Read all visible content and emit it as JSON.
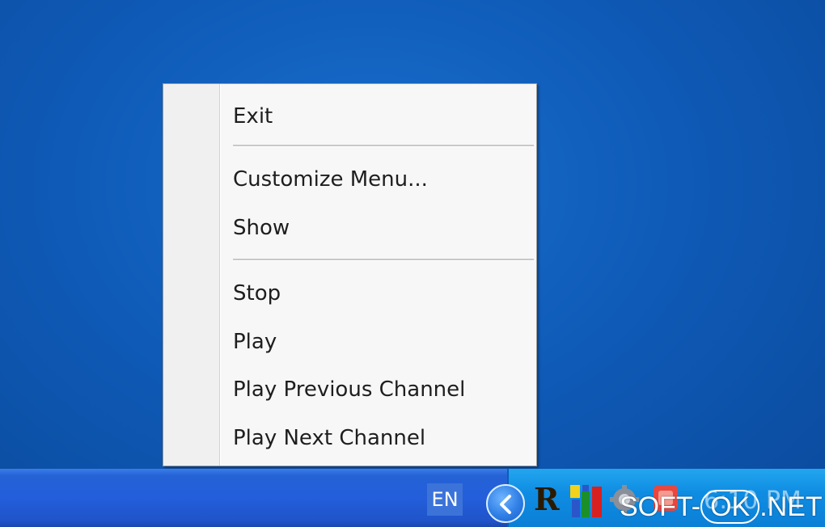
{
  "context_menu": {
    "items": [
      {
        "label": "Exit"
      },
      {
        "label": "Customize Menu..."
      },
      {
        "label": "Show"
      },
      {
        "label": "Stop"
      },
      {
        "label": "Play"
      },
      {
        "label": "Play Previous Channel"
      },
      {
        "label": "Play Next Channel"
      }
    ]
  },
  "taskbar": {
    "language": "EN",
    "clock": "6:10 PM",
    "tray_icons": [
      "chevron-left-icon",
      "r-app-icon",
      "bar-chart-app-icon",
      "gear-app-icon",
      "red-app-icon"
    ]
  },
  "watermark": {
    "left": "SOFT-",
    "ok": "OK",
    "right": ".NET"
  },
  "colors": {
    "desktop": "#0f5bb8",
    "taskbar": "#245edb",
    "tray": "#0f8de3",
    "menu_bg": "#f7f7f7"
  }
}
